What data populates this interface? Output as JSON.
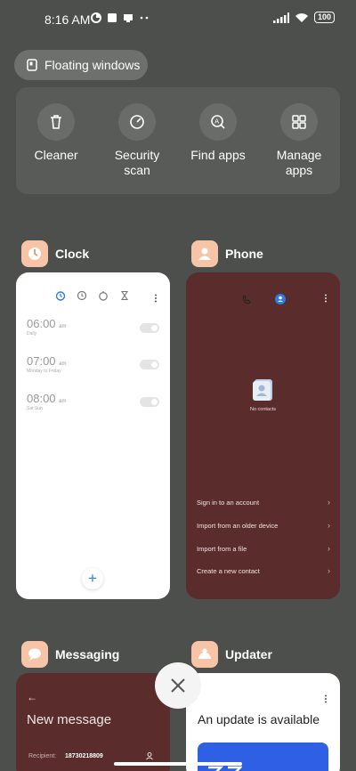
{
  "status": {
    "time": "8:16 AM",
    "battery": "100"
  },
  "floating_windows": {
    "label": "Floating windows"
  },
  "tools": [
    {
      "label": "Cleaner",
      "icon": "trash-icon"
    },
    {
      "label": "Security\nscan",
      "icon": "security-icon"
    },
    {
      "label": "Find apps",
      "icon": "find-apps-icon"
    },
    {
      "label": "Manage\napps",
      "icon": "grid-icon"
    }
  ],
  "apps": {
    "clock": {
      "name": "Clock",
      "alarms": [
        {
          "time": "06:00",
          "ampm": "am",
          "sub": "Daily"
        },
        {
          "time": "07:00",
          "ampm": "am",
          "sub": "Monday to Friday"
        },
        {
          "time": "08:00",
          "ampm": "am",
          "sub": "Sat Sun"
        }
      ]
    },
    "phone": {
      "name": "Phone",
      "no_contacts": "No contacts",
      "items": [
        "Sign in to an account",
        "Import from an older device",
        "Import from a file",
        "Create a new contact"
      ]
    },
    "messaging": {
      "name": "Messaging",
      "title": "New message",
      "recipient_label": "Recipient:",
      "recipient_value": "18730218809"
    },
    "updater": {
      "name": "Updater",
      "title": "An update is available"
    }
  },
  "colors": {
    "background": "#4d4f4c",
    "dark_card": "#5a2d2c",
    "accent_blue": "#2a7be4",
    "app_icon": "#f6c5a8"
  }
}
